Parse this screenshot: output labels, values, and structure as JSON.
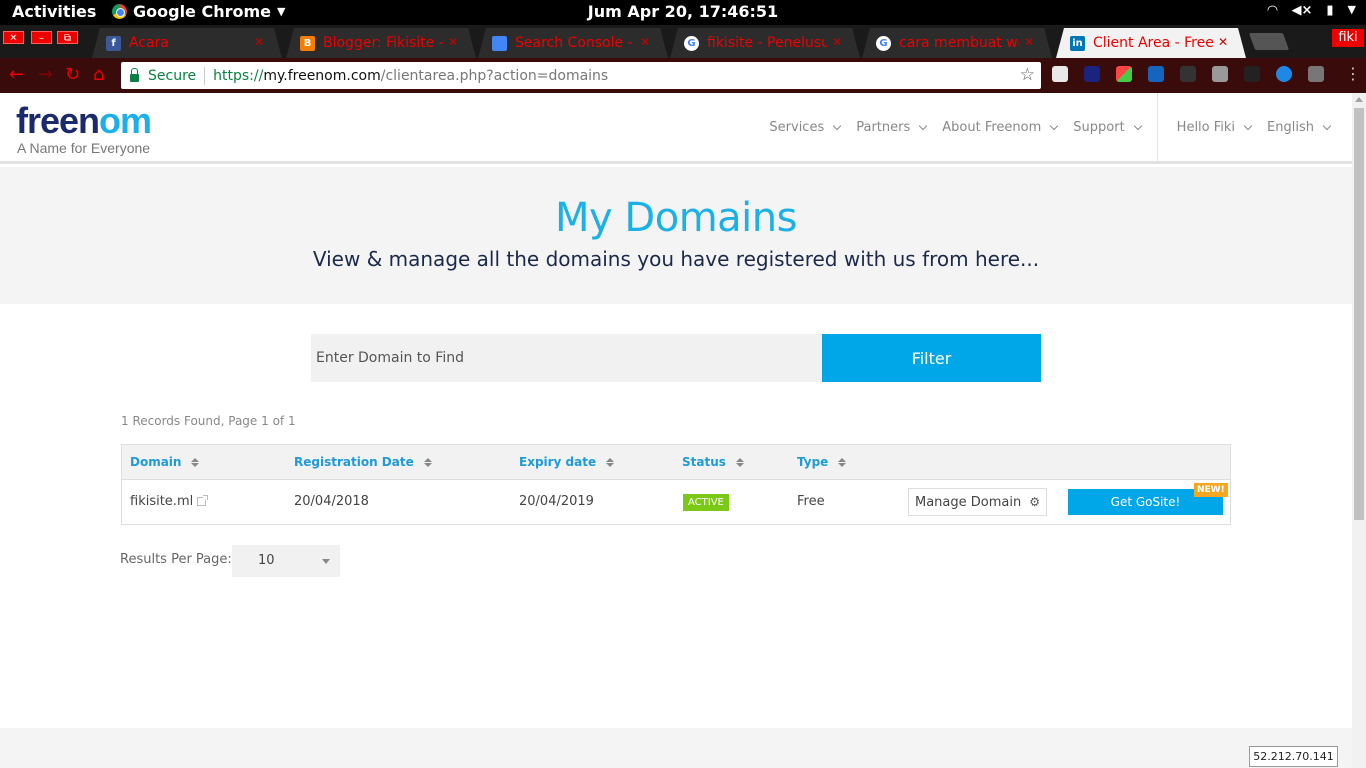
{
  "system": {
    "activities": "Activities",
    "app_name": "Google Chrome",
    "clock": "Jum Apr 20, 17:46:51"
  },
  "browser": {
    "tabs": [
      {
        "title": "Acara",
        "favicon": "facebook-icon",
        "color": "#3b5998"
      },
      {
        "title": "Blogger: Fikisite - B",
        "favicon": "blogger-icon",
        "color": "#f57d00"
      },
      {
        "title": "Search Console - Fi",
        "favicon": "search-console-icon",
        "color": "#4285f4"
      },
      {
        "title": "fikisite - Penelusura",
        "favicon": "google-icon",
        "color": "#ffffff"
      },
      {
        "title": "cara membuat web",
        "favicon": "google-icon",
        "color": "#ffffff"
      },
      {
        "title": "Client Area - Freenom",
        "favicon": "linkedin-icon",
        "color": "#0077b5"
      }
    ],
    "profile": "fiki",
    "secure_label": "Secure",
    "url_scheme": "https://",
    "url_host": "my.freenom.com",
    "url_path": "/clientarea.php?action=domains"
  },
  "site": {
    "logo_main": "freen",
    "logo_accent": "om",
    "tagline": "A Name for Everyone",
    "nav": [
      "Services",
      "Partners",
      "About Freenom",
      "Support"
    ],
    "user": "Hello Fiki",
    "language": "English"
  },
  "hero": {
    "title": "My Domains",
    "subtitle": "View & manage all the domains you have registered with us from here..."
  },
  "search": {
    "placeholder": "Enter Domain to Find",
    "button": "Filter"
  },
  "records": "1 Records Found, Page 1 of 1",
  "table": {
    "headers": [
      "Domain",
      "Registration Date",
      "Expiry date",
      "Status",
      "Type"
    ],
    "rows": [
      {
        "domain": "fikisite.ml",
        "registration": "20/04/2018",
        "expiry": "20/04/2019",
        "status": "ACTIVE",
        "type": "Free",
        "manage": "Manage Domain",
        "gosite": "Get GoSite!",
        "badge": "NEW!"
      }
    ]
  },
  "pagination": {
    "label": "Results Per Page:",
    "value": "10"
  },
  "ip": "52.212.70.141",
  "colors": {
    "brand_blue": "#1bb1e8",
    "brand_navy": "#1b2a6b",
    "button_blue": "#00a7e8",
    "active_green": "#7cc817",
    "new_orange": "#f5a623"
  }
}
